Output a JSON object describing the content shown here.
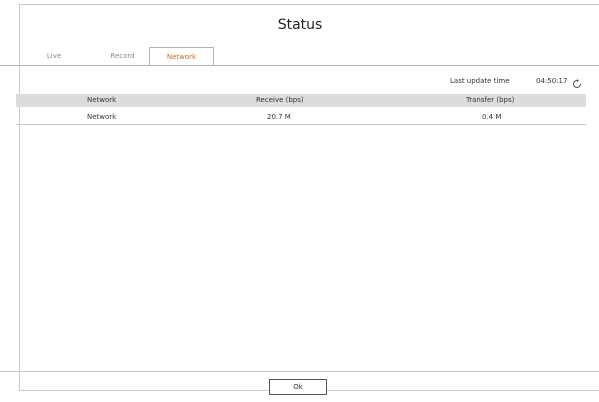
{
  "title": "Status",
  "tabs": [
    {
      "label": "Live"
    },
    {
      "label": "Record"
    },
    {
      "label": "Network"
    }
  ],
  "active_tab": "Network",
  "last_update": {
    "label": "Last update time",
    "time": "04:50:17"
  },
  "table": {
    "columns": [
      "Network",
      "Receive (bps)",
      "Transfer (bps)"
    ],
    "rows": [
      {
        "network": "Network",
        "receive": "20.7 M",
        "transfer": "0.4 M"
      }
    ]
  },
  "footer": {
    "ok_label": "Ok"
  },
  "colors": {
    "active_tab_text": "#d2691e",
    "header_bg": "#dcdcdc",
    "border": "#c9c9c9"
  },
  "icons": {
    "refresh": "refresh-icon"
  }
}
